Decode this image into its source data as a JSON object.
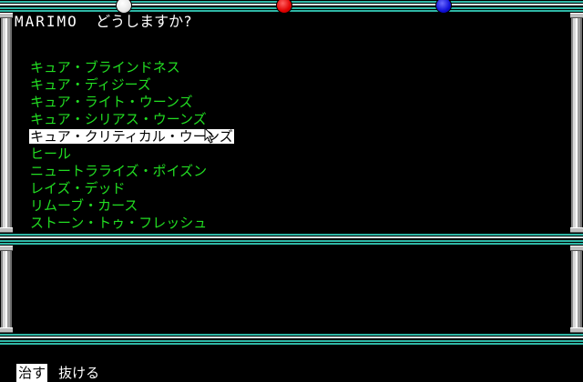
{
  "prompt": {
    "character": "MARIMO",
    "question": "どうしますか?"
  },
  "spells": [
    {
      "label": "キュア・ブラインドネス",
      "selected": false
    },
    {
      "label": "キュア・ディジーズ",
      "selected": false
    },
    {
      "label": "キュア・ライト・ウーンズ",
      "selected": false
    },
    {
      "label": "キュア・シリアス・ウーンズ",
      "selected": false
    },
    {
      "label": "キュア・クリティカル・ウーンズ",
      "selected": true
    },
    {
      "label": "ヒール",
      "selected": false
    },
    {
      "label": "ニュートラライズ・ポイズン",
      "selected": false
    },
    {
      "label": "レイズ・デッド",
      "selected": false
    },
    {
      "label": "リムーブ・カース",
      "selected": false
    },
    {
      "label": "ストーン・トゥ・フレッシュ",
      "selected": false
    }
  ],
  "commands": {
    "cure": "治す",
    "exit": "抜ける"
  },
  "colors": {
    "spell_text": "#22dd22",
    "frame_teal": "#2fb7a6",
    "gem_white": "#ffffff",
    "gem_red": "#e00000",
    "gem_blue": "#1010d8"
  },
  "icons": {
    "cursor": "mouse-pointer-icon"
  }
}
